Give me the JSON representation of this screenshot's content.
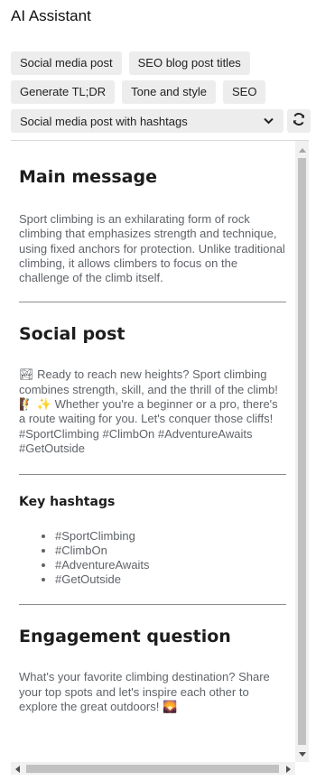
{
  "app": {
    "title": "AI Assistant"
  },
  "prompts": {
    "row1": [
      "Social media post",
      "SEO blog post titles"
    ],
    "row2": [
      "Generate TL;DR",
      "Tone and style",
      "SEO"
    ],
    "selected_template": "Social media post with hashtags"
  },
  "icons": {
    "caret": "chevron-down-icon",
    "refresh": "refresh-icon",
    "emoji_wave": "beach-emoji",
    "emoji_climb": "climbing-emoji",
    "emoji_sparkles": "sparkles-emoji",
    "emoji_mountain": "sunrise-mountain-emoji"
  },
  "sections": {
    "main": {
      "heading": "Main message",
      "body": "Sport climbing is an exhilarating form of rock climbing that emphasizes strength and technique, using fixed anchors for protection. Unlike traditional climbing, it allows climbers to focus on the challenge of the climb itself."
    },
    "social": {
      "heading": "Social post",
      "emoji_1": "🏞",
      "text_1": " Ready to reach new heights? Sport climbing combines strength, skill, and the thrill of the climb! ",
      "emoji_2": "🧗 ✨",
      "text_2": " Whether you're a beginner or a pro, there's a route waiting for you. Let's conquer those cliffs! #SportClimbing #ClimbOn #AdventureAwaits #GetOutside"
    },
    "hashtags": {
      "heading": "Key hashtags",
      "items": [
        "#SportClimbing",
        "#ClimbOn",
        "#AdventureAwaits",
        "#GetOutside"
      ]
    },
    "engagement": {
      "heading": "Engagement question",
      "text": "What's your favorite climbing destination? Share your top spots and let's inspire each other to explore the great outdoors! ",
      "emoji": "🌄"
    }
  },
  "colors": {
    "chip_bg": "#ededed",
    "body_text": "#5f6368",
    "heading": "#1d1d1d",
    "divider": "#8c8c8c"
  }
}
